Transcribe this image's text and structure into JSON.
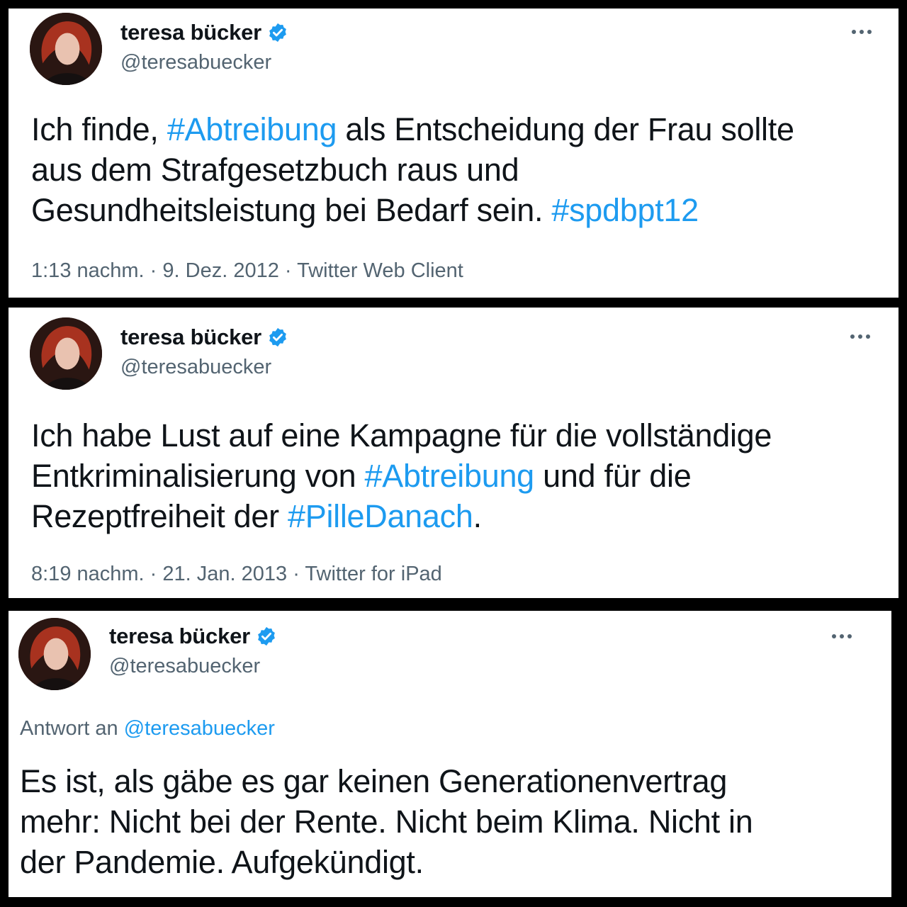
{
  "colors": {
    "link": "#1d9bf0",
    "secondary_text": "#536471",
    "verified_badge": "#1d9bf0"
  },
  "tweets": [
    {
      "author_name": "teresa bücker",
      "handle": "@teresabuecker",
      "verified_icon": "verified-badge-icon",
      "more_icon": "more-dots-icon",
      "text_parts": [
        {
          "text": "Ich finde, "
        },
        {
          "text": "#Abtreibung",
          "hashtag": true
        },
        {
          "text": " als Entscheidung der Frau sollte\naus dem Strafgesetzbuch raus und\nGesundheitsleistung bei Bedarf sein. "
        },
        {
          "text": "#spdbpt12",
          "hashtag": true
        }
      ],
      "time": "1:13 nachm.",
      "date": "9. Dez. 2012",
      "source": "Twitter Web Client"
    },
    {
      "author_name": "teresa bücker",
      "handle": "@teresabuecker",
      "verified_icon": "verified-badge-icon",
      "more_icon": "more-dots-icon",
      "text_parts": [
        {
          "text": "Ich habe Lust auf eine Kampagne für die vollständige\nEntkriminalisierung von "
        },
        {
          "text": "#Abtreibung",
          "hashtag": true
        },
        {
          "text": " und für die\nRezeptfreiheit der "
        },
        {
          "text": "#PilleDanach",
          "hashtag": true
        },
        {
          "text": "."
        }
      ],
      "time": "8:19 nachm.",
      "date": "21. Jan. 2013",
      "source": "Twitter for iPad"
    },
    {
      "author_name": "teresa bücker",
      "handle": "@teresabuecker",
      "verified_icon": "verified-badge-icon",
      "more_icon": "more-dots-icon",
      "reply_prefix": "Antwort an",
      "reply_handle": "@teresabuecker",
      "text_parts": [
        {
          "text": "Es ist, als gäbe es gar keinen Generationenvertrag\nmehr: Nicht bei der Rente. Nicht beim Klima. Nicht in\nder Pandemie. Aufgekündigt."
        }
      ]
    }
  ]
}
